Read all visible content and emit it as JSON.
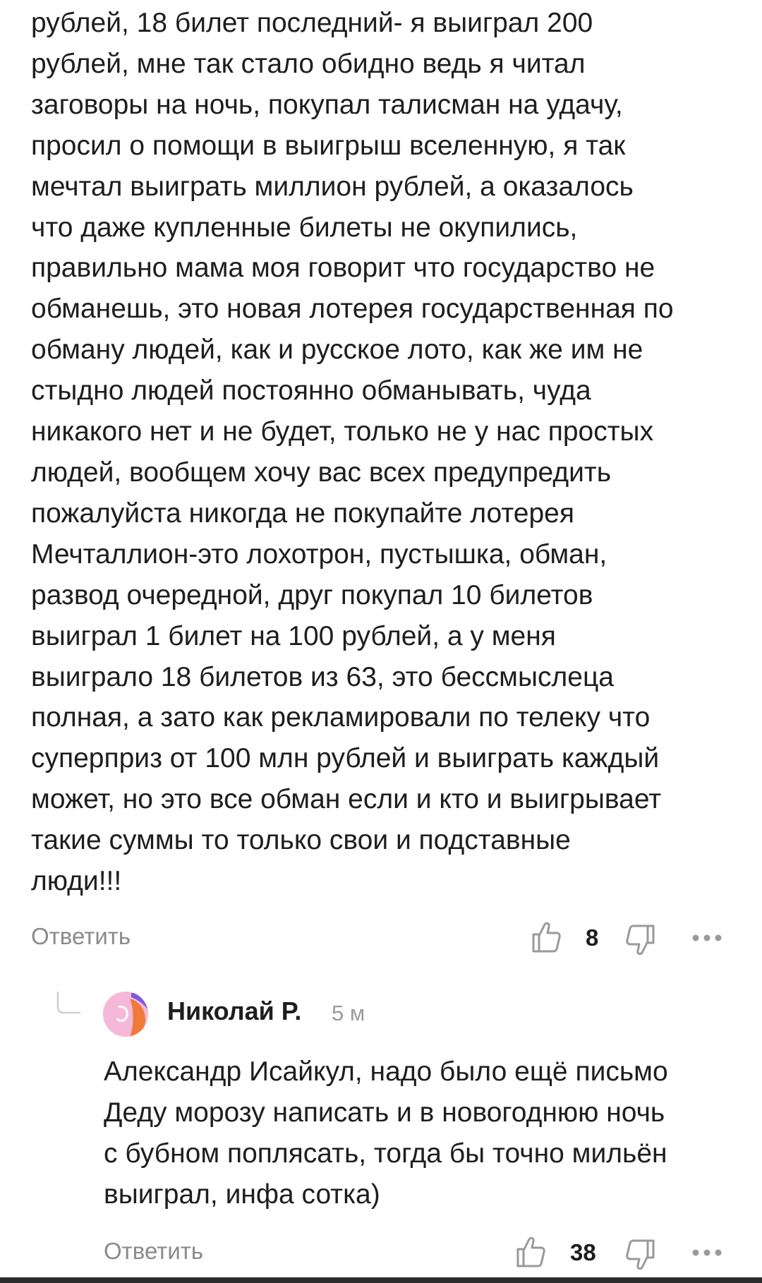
{
  "comment": {
    "lines": [
      "рублей, 18 билет последний- я выиграл 200",
      "рублей, мне так стало обидно ведь я читал",
      "заговоры на ночь, покупал талисман на удачу,",
      "просил о помощи в выигрыш вселенную, я так",
      "мечтал выиграть миллион рублей, а оказалось",
      "что даже купленные билеты не окупились,",
      "правильно мама моя говорит что государство не",
      "обманешь, это новая лотерея государственная по",
      "обману людей, как и русское лото, как же им не",
      "стыдно людей постоянно обманывать, чуда",
      "никакого нет и не будет, только не у нас простых",
      "людей, вообщем хочу вас всех предупредить",
      "пожалуйста никогда не покупайте лотерея",
      "Мечталлион-это лохотрон, пустышка, обман,",
      "развод очередной, друг покупал 10 билетов",
      "выиграл 1 билет на 100 рублей, а у меня",
      "выиграло 18 билетов из 63, это бессмыслеца",
      "полная, а зато как рекламировали по телеку что",
      "суперприз от 100 млн рублей и выиграть каждый",
      "может, но это все обман если и кто и выигрывает",
      "такие суммы то только свои и подставные",
      "люди!!!"
    ],
    "reply_label": "Ответить",
    "likes": "8"
  },
  "reply": {
    "author": "Николай Р.",
    "time": "5 м",
    "lines": [
      "Александр Исайкул, надо было ещё письмо",
      "Деду морозу написать и в новогоднюю ночь",
      "с бубном поплясать, тогда бы точно мильён",
      "выиграл, инфа сотка)"
    ],
    "reply_label": "Ответить",
    "likes": "38"
  },
  "icons": {
    "like": "thumbs-up-icon",
    "dislike": "thumbs-down-icon",
    "more": "more-dots-icon",
    "thread": "thread-corner-icon"
  },
  "colors": {
    "text": "#1e1e1e",
    "muted": "#8a8a8a",
    "icon": "#9a9a9a",
    "avatar_pink": "#f6b8d8",
    "avatar_orange": "#f07a3a",
    "avatar_purple": "#7a5be0"
  }
}
